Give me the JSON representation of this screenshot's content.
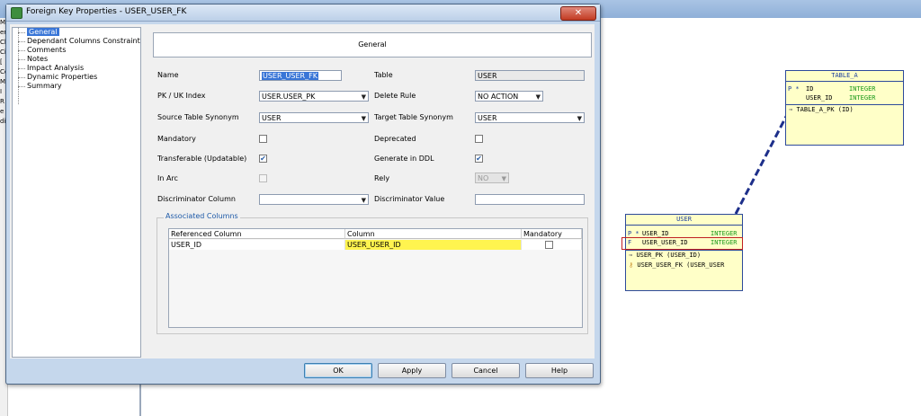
{
  "window": {
    "title": "Foreign Key Properties - USER_USER_FK",
    "close_glyph": "✕"
  },
  "tree": {
    "items": [
      {
        "label": "General",
        "selected": true
      },
      {
        "label": "Dependant Columns Constraint"
      },
      {
        "label": "Comments"
      },
      {
        "label": "Notes"
      },
      {
        "label": "Impact Analysis"
      },
      {
        "label": "Dynamic Properties"
      },
      {
        "label": "Summary"
      }
    ]
  },
  "header": {
    "title": "General"
  },
  "form": {
    "name_label": "Name",
    "name_value": "USER_USER_FK",
    "table_label": "Table",
    "table_value": "USER",
    "pkuk_label": "PK / UK Index",
    "pkuk_value": "USER.USER_PK",
    "delete_rule_label": "Delete Rule",
    "delete_rule_value": "NO ACTION",
    "source_syn_label": "Source Table Synonym",
    "source_syn_value": "USER",
    "target_syn_label": "Target Table Synonym",
    "target_syn_value": "USER",
    "mandatory_label": "Mandatory",
    "mandatory_checked": false,
    "deprecated_label": "Deprecated",
    "deprecated_checked": false,
    "transferable_label": "Transferable (Updatable)",
    "transferable_checked": true,
    "generate_ddl_label": "Generate in DDL",
    "generate_ddl_checked": true,
    "in_arc_label": "In Arc",
    "in_arc_checked": false,
    "rely_label": "Rely",
    "rely_value": "NO",
    "discriminator_col_label": "Discriminator Column",
    "discriminator_col_value": "",
    "discriminator_val_label": "Discriminator Value",
    "discriminator_val_value": ""
  },
  "associated": {
    "title": "Associated Columns",
    "headers": [
      "Referenced Column",
      "Column",
      "Mandatory"
    ],
    "rows": [
      {
        "referenced": "USER_ID",
        "column": "USER_USER_ID",
        "mandatory": false
      }
    ]
  },
  "buttons": {
    "ok": "OK",
    "apply": "Apply",
    "cancel": "Cancel",
    "help": "Help"
  },
  "diagram": {
    "table_a": {
      "name": "TABLE_A",
      "columns": [
        {
          "key": "P *",
          "name": "ID",
          "type": "INTEGER"
        },
        {
          "key": "",
          "name": "USER_ID",
          "type": "INTEGER"
        }
      ],
      "constraints": [
        {
          "icon": "pk-key-icon",
          "label": "TABLE_A_PK (ID)"
        }
      ]
    },
    "user": {
      "name": "USER",
      "columns": [
        {
          "key": "P *",
          "name": "USER_ID",
          "type": "INTEGER"
        },
        {
          "key": "F",
          "name": "USER_USER_ID",
          "type": "INTEGER"
        }
      ],
      "constraints": [
        {
          "icon": "pk-key-icon",
          "label": "USER_PK (USER_ID)"
        },
        {
          "icon": "fk-key-icon",
          "label": "USER_USER_FK (USER_USER"
        }
      ]
    }
  },
  "left_strip": [
    "Mo",
    "er",
    "Cl",
    "Ci",
    "[",
    "Cc",
    "M",
    "I",
    "R",
    "e",
    "di"
  ],
  "colors": {
    "accent": "#3875d7",
    "entity_fill": "#ffffc8",
    "entity_border": "#2d4a9a",
    "highlight_yellow": "#fff44f",
    "relation_line": "#1d2f8a"
  }
}
